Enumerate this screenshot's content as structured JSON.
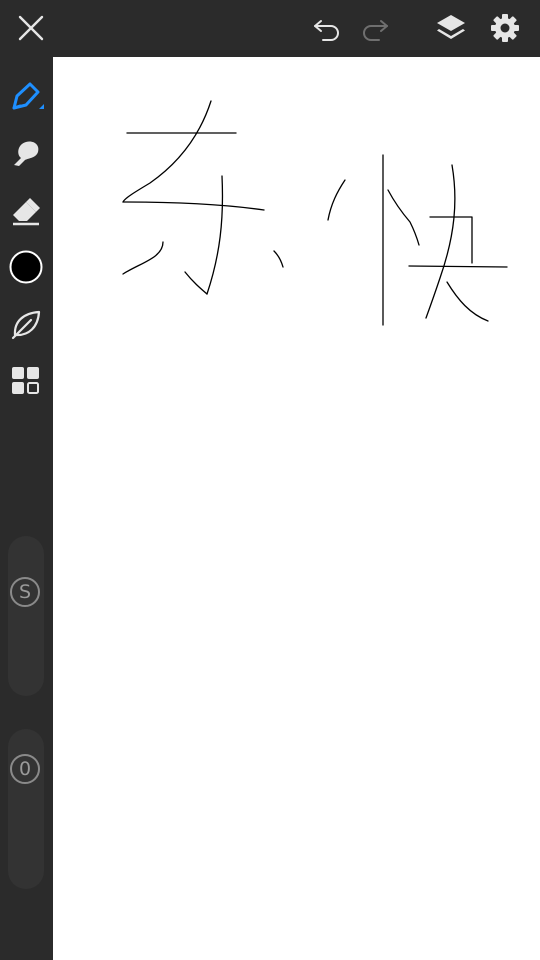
{
  "app": {
    "colors": {
      "chrome_bg": "#2b2b2b",
      "icon": "#e6e6e6",
      "icon_disabled": "#6f6f6f",
      "accent": "#1e8fff",
      "canvas": "#ffffff",
      "ink": "#000000"
    }
  },
  "topbar": {
    "close_icon": "close-icon",
    "undo_icon": "undo-icon",
    "redo_icon": "redo-icon",
    "redo_enabled": false,
    "layers_icon": "layers-icon",
    "settings_icon": "gear-icon"
  },
  "sidebar": {
    "tools": [
      {
        "name": "pen",
        "icon": "pen-icon",
        "selected": true
      },
      {
        "name": "smudge",
        "icon": "smudge-icon",
        "selected": false
      },
      {
        "name": "eraser",
        "icon": "eraser-icon",
        "selected": false
      },
      {
        "name": "color",
        "icon": "color-swatch",
        "selected": false,
        "color": "#000000"
      },
      {
        "name": "brush-style",
        "icon": "leaf-icon",
        "selected": false
      },
      {
        "name": "more",
        "icon": "grid-icon",
        "selected": false
      }
    ],
    "size_slider": {
      "label": "S"
    },
    "opacity_slider": {
      "label": "0"
    }
  },
  "canvas": {
    "strokes_description_hidden": true
  }
}
